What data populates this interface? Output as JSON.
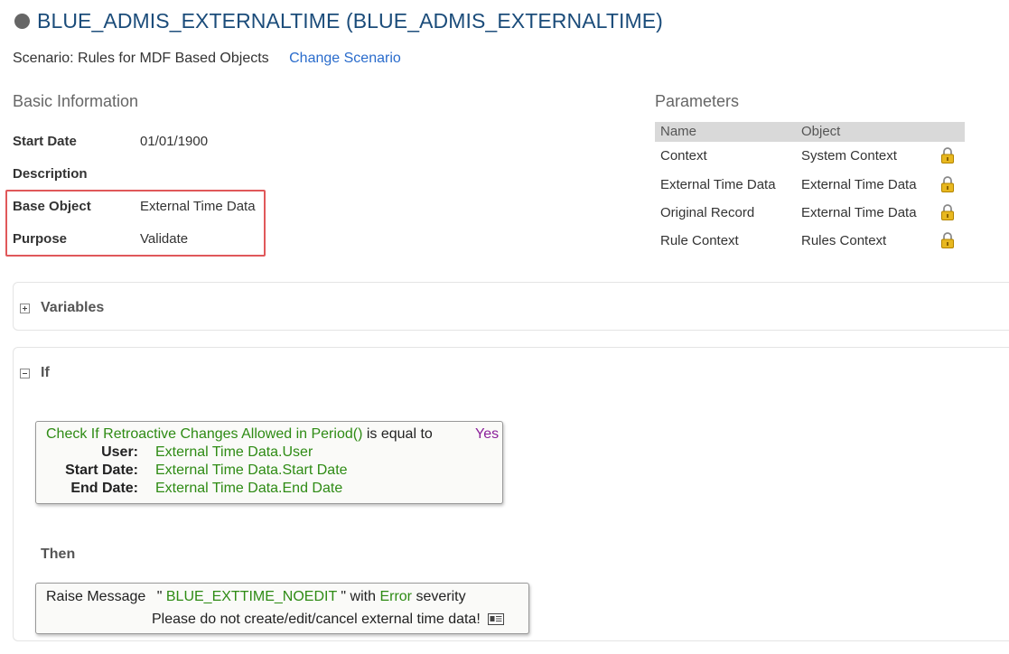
{
  "header": {
    "title": "BLUE_ADMIS_EXTERNALTIME (BLUE_ADMIS_EXTERNALTIME)",
    "status_icon": "status-dot-icon"
  },
  "scenario": {
    "label": "Scenario: Rules for MDF Based Objects",
    "change_link": "Change Scenario"
  },
  "basic_info": {
    "title": "Basic Information",
    "fields": [
      {
        "label": "Start Date",
        "value": "01/01/1900"
      },
      {
        "label": "Description",
        "value": ""
      },
      {
        "label": "Base Object",
        "value": "External Time Data"
      },
      {
        "label": "Purpose",
        "value": "Validate"
      }
    ],
    "highlight_color": "#e0585a"
  },
  "parameters": {
    "title": "Parameters",
    "columns": [
      "Name",
      "Object"
    ],
    "rows": [
      {
        "name": "Context",
        "object": "System Context",
        "icon": "lock-icon"
      },
      {
        "name": "External Time Data",
        "object": "External Time Data",
        "icon": "lock-icon"
      },
      {
        "name": "Original Record",
        "object": "External Time Data",
        "icon": "lock-icon"
      },
      {
        "name": "Rule Context",
        "object": "Rules Context",
        "icon": "lock-icon"
      }
    ]
  },
  "variables_panel": {
    "title": "Variables",
    "expanded": false
  },
  "if_panel": {
    "title": "If",
    "expanded": true,
    "condition": {
      "function": "Check If Retroactive Changes Allowed in Period()",
      "operator": "is equal to",
      "value": "Yes",
      "args": [
        {
          "label": "User:",
          "value": "External Time Data.User"
        },
        {
          "label": "Start Date:",
          "value": "External Time Data.Start Date"
        },
        {
          "label": "End Date:",
          "value": "External Time Data.End Date"
        }
      ]
    },
    "then_label": "Then",
    "action": {
      "prefix": "Raise Message",
      "open_quote": "\"",
      "message_key": "BLUE_EXTTIME_NOEDIT",
      "close_quote": "\" with",
      "severity": "Error",
      "severity_suffix": "severity",
      "message_text": "Please do not create/edit/cancel external time data!",
      "icon": "message-details-icon"
    }
  },
  "colors": {
    "title": "#1b4c7a",
    "link": "#2a6ccc",
    "expression_green": "#2e8b14",
    "value_purple": "#8a1f9a"
  }
}
